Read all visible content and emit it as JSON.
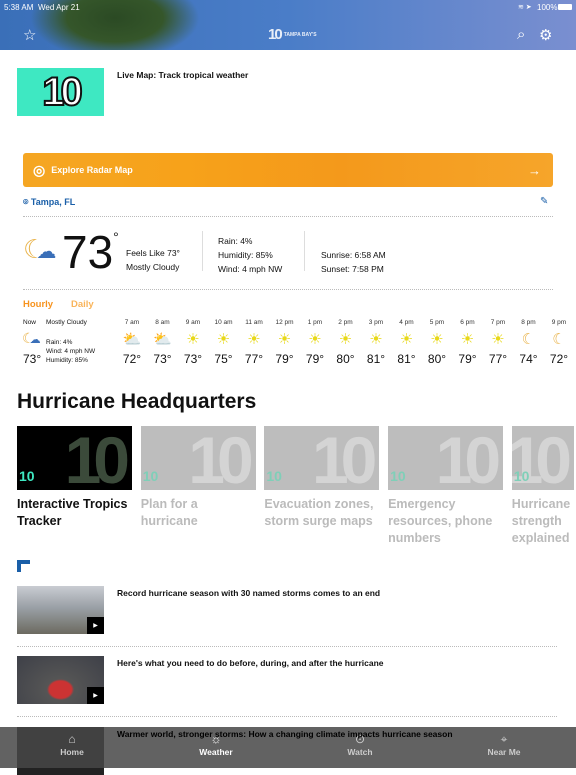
{
  "status": {
    "time": "5:38 AM",
    "date": "Wed Apr 21",
    "battery": "100%"
  },
  "header": {
    "logo": "10",
    "logo_sub": "TAMPA BAY'S",
    "icons": [
      "star-icon",
      "search-icon",
      "gear-icon"
    ]
  },
  "promo": {
    "thumb_text": "10",
    "title": "Live Map: Track tropical weather"
  },
  "radar": {
    "label": "Explore Radar Map",
    "color": "#f5a623"
  },
  "location": {
    "name": "Tampa, FL"
  },
  "current": {
    "temp": "73",
    "deg": "°",
    "feels_like": "Feels Like 73°",
    "condition": "Mostly Cloudy",
    "rain": "Rain: 4%",
    "humidity": "Humidity: 85%",
    "wind": "Wind: 4 mph NW",
    "sunrise": "Sunrise: 6:58 AM",
    "sunset": "Sunset: 7:58 PM"
  },
  "forecast_tabs": [
    "Hourly",
    "Daily"
  ],
  "now": {
    "label": "Now",
    "condition": "Mostly Cloudy",
    "rain": "Rain: 4%",
    "wind": "Wind: 4 mph NW",
    "humidity": "Humidity: 85%",
    "temp": "73°"
  },
  "hours": [
    {
      "time": "7 am",
      "temp": "72°",
      "icon": "partly-sunny"
    },
    {
      "time": "8 am",
      "temp": "73°",
      "icon": "partly-sunny"
    },
    {
      "time": "9 am",
      "temp": "73°",
      "icon": "sunny"
    },
    {
      "time": "10 am",
      "temp": "75°",
      "icon": "sunny"
    },
    {
      "time": "11 am",
      "temp": "77°",
      "icon": "sunny"
    },
    {
      "time": "12 pm",
      "temp": "79°",
      "icon": "sunny"
    },
    {
      "time": "1 pm",
      "temp": "79°",
      "icon": "sunny"
    },
    {
      "time": "2 pm",
      "temp": "80°",
      "icon": "sunny"
    },
    {
      "time": "3 pm",
      "temp": "81°",
      "icon": "sunny"
    },
    {
      "time": "4 pm",
      "temp": "81°",
      "icon": "sunny"
    },
    {
      "time": "5 pm",
      "temp": "80°",
      "icon": "sunny"
    },
    {
      "time": "6 pm",
      "temp": "79°",
      "icon": "sunny"
    },
    {
      "time": "7 pm",
      "temp": "77°",
      "icon": "sunny"
    },
    {
      "time": "8 pm",
      "temp": "74°",
      "icon": "moon"
    },
    {
      "time": "9 pm",
      "temp": "72°",
      "icon": "moon"
    }
  ],
  "section": {
    "title": "Hurricane Headquarters"
  },
  "cards": [
    {
      "title": "Interactive Tropics Tracker",
      "active": true
    },
    {
      "title": "Plan for a hurricane",
      "active": false
    },
    {
      "title": "Evacuation zones, storm surge maps",
      "active": false
    },
    {
      "title": "Emergency resources, phone numbers",
      "active": false
    },
    {
      "title": "Hurricane strength explained",
      "active": false
    }
  ],
  "articles": [
    {
      "title": "Record hurricane season with 30 named storms comes to an end"
    },
    {
      "title": "Here's what you need to do before, during, and after the hurricane"
    },
    {
      "title": "Warmer world, stronger storms: How a changing climate impacts hurricane season"
    }
  ],
  "tabbar": [
    {
      "label": "Home",
      "icon": "home-icon"
    },
    {
      "label": "Weather",
      "icon": "sun-icon",
      "active": true
    },
    {
      "label": "Watch",
      "icon": "play-circle-icon"
    },
    {
      "label": "Near Me",
      "icon": "location-pin-icon"
    }
  ]
}
